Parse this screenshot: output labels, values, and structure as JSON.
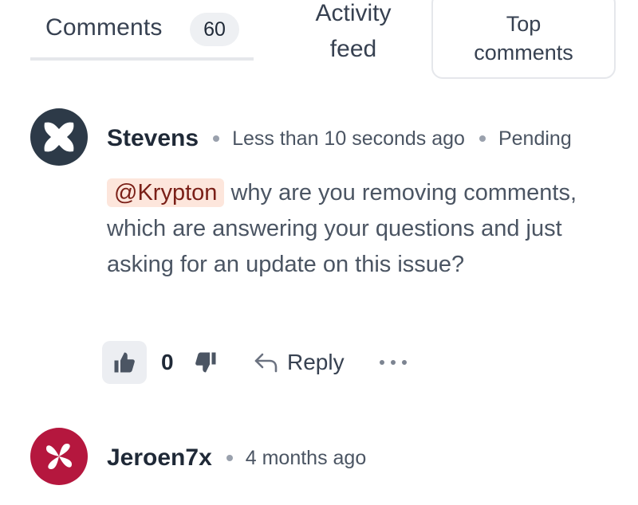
{
  "tabs": {
    "comments": {
      "label": "Comments",
      "count": "60"
    },
    "activity": {
      "line1": "Activity",
      "line2": "feed"
    },
    "top": {
      "line1": "Top",
      "line2": "comments"
    }
  },
  "comments": [
    {
      "author": "Stevens",
      "time": "Less than 10 seconds ago",
      "status": "Pending",
      "mention": "@Krypton",
      "text": " why are you removing comments, which are answering your questions and just asking for an update on this issue?",
      "likes": "0",
      "reply_label": "Reply",
      "avatar_color": "#2d3a48"
    },
    {
      "author": "Jeroen7x",
      "time": "4 months ago",
      "avatar_color": "#b5173e"
    }
  ],
  "icons": {
    "thumbs_up": "thumbs-up-icon",
    "thumbs_down": "thumbs-down-icon",
    "reply": "reply-arrow-icon",
    "more": "more-dots-icon"
  },
  "colors": {
    "mention_bg": "#fde6dc",
    "mention_text": "#7a1f17",
    "tab_border": "#e5e7eb"
  }
}
